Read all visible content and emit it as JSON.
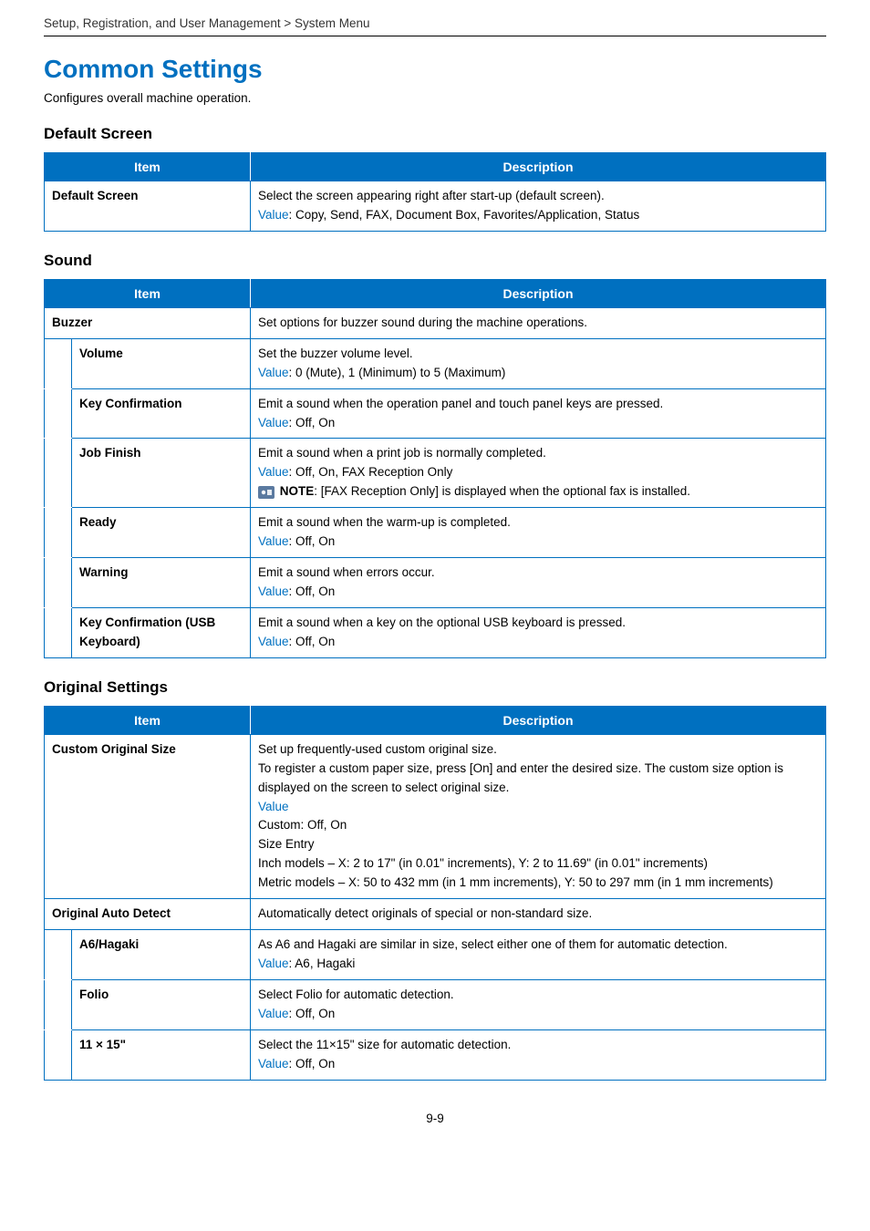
{
  "breadcrumb": "Setup, Registration, and User Management > System Menu",
  "title": "Common Settings",
  "intro": "Configures overall machine operation.",
  "footer": "9-9",
  "default_screen": {
    "heading": "Default Screen",
    "head_item": "Item",
    "head_desc": "Description",
    "row_label": "Default Screen",
    "desc1": "Select the screen appearing right after start-up (default screen).",
    "value_prefix": "Value",
    "value_text": ": Copy, Send, FAX, Document Box, Favorites/Application, Status"
  },
  "sound": {
    "heading": "Sound",
    "head_item": "Item",
    "head_desc": "Description",
    "buzzer_label": "Buzzer",
    "buzzer_desc": "Set options for buzzer sound during the machine operations.",
    "rows": {
      "volume": {
        "label": "Volume",
        "desc": "Set the buzzer volume level.",
        "value_prefix": "Value",
        "value_text": ": 0 (Mute), 1 (Minimum) to 5 (Maximum)"
      },
      "key_conf": {
        "label": "Key Confirmation",
        "desc": "Emit a sound when the operation panel and touch panel keys are pressed.",
        "value_prefix": "Value",
        "value_text": ": Off, On"
      },
      "job_finish": {
        "label": "Job Finish",
        "desc": "Emit a sound when a print job is normally completed.",
        "value_prefix": "Value",
        "value_text": ": Off, On, FAX Reception Only",
        "note_bold": "NOTE",
        "note_text": ": [FAX Reception Only] is displayed when the optional fax is installed."
      },
      "ready": {
        "label": "Ready",
        "desc": "Emit a sound when the warm-up is completed.",
        "value_prefix": "Value",
        "value_text": ": Off, On"
      },
      "warning": {
        "label": "Warning",
        "desc": "Emit a sound when errors occur.",
        "value_prefix": "Value",
        "value_text": ": Off, On"
      },
      "key_usb": {
        "label": "Key Confirmation (USB Keyboard)",
        "desc": "Emit a sound when a key on the optional USB keyboard is pressed.",
        "value_prefix": "Value",
        "value_text": ": Off, On"
      }
    }
  },
  "original": {
    "heading": "Original Settings",
    "head_item": "Item",
    "head_desc": "Description",
    "custom": {
      "label": "Custom Original Size",
      "l1": "Set up frequently-used custom original size.",
      "l2": "To register a custom paper size, press [On] and enter the desired size. The custom size option is displayed on the screen to select original size.",
      "value_prefix": "Value",
      "l3": "Custom: Off, On",
      "l4": "Size Entry",
      "l5": "Inch models – X: 2 to 17\" (in 0.01\" increments), Y: 2 to 11.69\" (in 0.01\" increments)",
      "l6": "Metric models – X: 50 to 432 mm (in 1 mm increments), Y: 50 to 297 mm (in 1 mm increments)"
    },
    "auto_detect": {
      "label": "Original Auto Detect",
      "desc": "Automatically detect originals of special or non-standard size."
    },
    "a6": {
      "label": "A6/Hagaki",
      "desc": "As A6 and Hagaki are similar in size, select either one of them for automatic detection.",
      "value_prefix": "Value",
      "value_text": ": A6, Hagaki"
    },
    "folio": {
      "label": "Folio",
      "desc": "Select Folio for automatic detection.",
      "value_prefix": "Value",
      "value_text": ": Off, On"
    },
    "s11x15": {
      "label": "11 × 15\"",
      "desc": "Select the 11×15\" size for automatic detection.",
      "value_prefix": "Value",
      "value_text": ": Off, On"
    }
  }
}
